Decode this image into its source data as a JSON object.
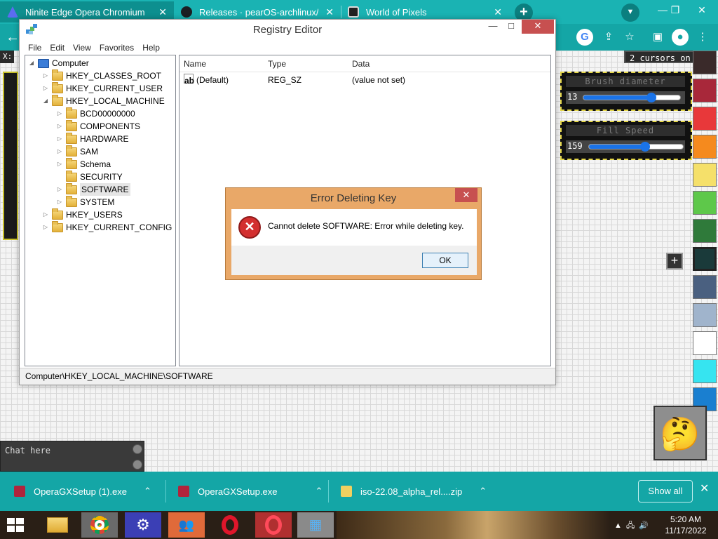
{
  "browser": {
    "tabs": [
      {
        "label": "Ninite Edge Opera Chromium Un",
        "icon": "ninite-icon"
      },
      {
        "label": "Releases · pearOS-archlinux/iso",
        "icon": "github-icon"
      },
      {
        "label": "World of Pixels",
        "icon": "world-of-pixels-icon"
      }
    ],
    "new_tab_symbol": "+",
    "accent_color": "#14a6a6"
  },
  "game": {
    "coord_label": "X:",
    "cursors_label": "2 cursors on",
    "brush": {
      "title": "Brush diameter",
      "value": "13",
      "fraction": 0.7
    },
    "fill": {
      "title": "Fill Speed",
      "value": "159",
      "fraction": 0.6
    },
    "palette": [
      "#3a2a2a",
      "#a8283a",
      "#e8383a",
      "#f58a1e",
      "#f5e06a",
      "#5ec84a",
      "#2f7a3a",
      "#1a3a3a",
      "#4a6080",
      "#a0b4cc",
      "#ffffff",
      "#36e4f0",
      "#1a7fd0"
    ],
    "selected_swatch": 7,
    "plus_symbol": "+",
    "emoji": "🤔",
    "chat_placeholder": "Chat here"
  },
  "regedit": {
    "title": "Registry Editor",
    "menu": [
      "File",
      "Edit",
      "View",
      "Favorites",
      "Help"
    ],
    "tree": {
      "root": "Computer",
      "hives": [
        "HKEY_CLASSES_ROOT",
        "HKEY_CURRENT_USER",
        "HKEY_LOCAL_MACHINE"
      ],
      "hklm_children": [
        "BCD00000000",
        "COMPONENTS",
        "HARDWARE",
        "SAM",
        "Schema",
        "SECURITY",
        "SOFTWARE",
        "SYSTEM"
      ],
      "hives_after": [
        "HKEY_USERS",
        "HKEY_CURRENT_CONFIG"
      ]
    },
    "columns": [
      "Name",
      "Type",
      "Data"
    ],
    "values": [
      {
        "name": "(Default)",
        "type": "REG_SZ",
        "data": "(value not set)"
      }
    ],
    "status": "Computer\\HKEY_LOCAL_MACHINE\\SOFTWARE"
  },
  "dialog": {
    "title": "Error Deleting Key",
    "message": "Cannot delete SOFTWARE:  Error while deleting key.",
    "ok_label": "OK"
  },
  "downloads": {
    "items": [
      "OperaGXSetup (1).exe",
      "OperaGXSetup.exe",
      "iso-22.08_alpha_rel....zip"
    ],
    "show_all": "Show all"
  },
  "taskbar": {
    "time": "5:20 AM",
    "date": "11/17/2022"
  }
}
